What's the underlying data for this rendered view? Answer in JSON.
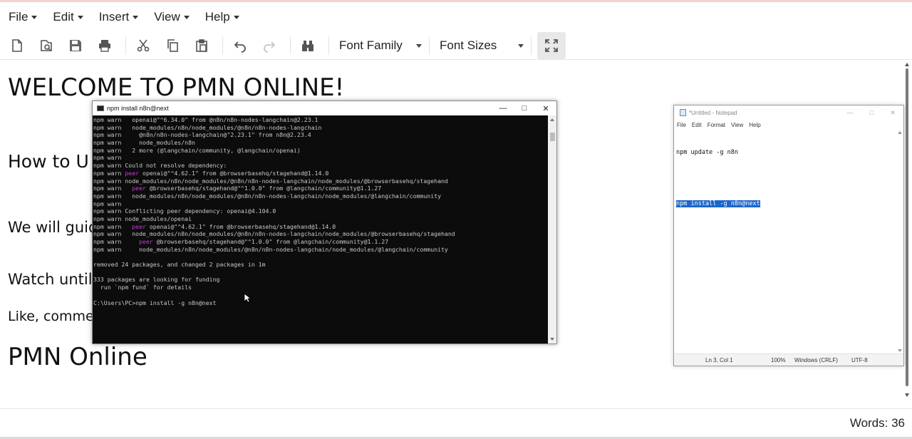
{
  "menubar": {
    "items": [
      "File",
      "Edit",
      "Insert",
      "View",
      "Help"
    ]
  },
  "toolbar": {
    "buttons": [
      "new-file-icon",
      "open-file-icon",
      "save-icon",
      "print-icon",
      "cut-icon",
      "copy-icon",
      "paste-icon",
      "undo-icon",
      "redo-icon",
      "find-icon"
    ],
    "font_family_label": "Font Family",
    "font_sizes_label": "Font Sizes",
    "fullscreen_icon": "fullscreen-icon"
  },
  "document": {
    "title": "WELCOME TO PMN ONLINE!",
    "line1": "How to U",
    "line2": "We will guid",
    "line3": "Watch until t",
    "line4": "Like, comme",
    "heading2": "PMN Online"
  },
  "statusbar": {
    "words": "Words: 36"
  },
  "cmd": {
    "title": "npm install n8n@next",
    "lines": [
      [
        "npm ",
        "warn",
        "   openai@\"^6.34.0\" from @n8n/n8n-nodes-langchain@2.23.1"
      ],
      [
        "npm ",
        "warn",
        "   node_modules/n8n/node_modules/@n8n/n8n-nodes-langchain"
      ],
      [
        "npm ",
        "warn",
        "     @n8n/n8n-nodes-langchain@\"2.23.1\" from n8n@2.23.4"
      ],
      [
        "npm ",
        "warn",
        "     node_modules/n8n"
      ],
      [
        "npm ",
        "warn",
        "   2 more (@langchain/community, @langchain/openai)"
      ],
      [
        "npm ",
        "warn",
        ""
      ],
      [
        "npm ",
        "warn",
        " Could not resolve dependency:"
      ],
      [
        "npm ",
        "warn",
        " peer openai@\"^4.62.1\" from @browserbasehq/stagehand@1.14.0"
      ],
      [
        "npm ",
        "warn",
        " node_modules/n8n/node_modules/@n8n/n8n-nodes-langchain/node_modules/@browserbasehq/stagehand"
      ],
      [
        "npm ",
        "warn",
        "   peer @browserbasehq/stagehand@\"^1.0.0\" from @langchain/community@1.1.27"
      ],
      [
        "npm ",
        "warn",
        "   node_modules/n8n/node_modules/@n8n/n8n-nodes-langchain/node_modules/@langchain/community"
      ],
      [
        "npm ",
        "warn",
        ""
      ],
      [
        "npm ",
        "warn",
        " Conflicting peer dependency: openai@4.104.0"
      ],
      [
        "npm ",
        "warn",
        " node_modules/openai"
      ],
      [
        "npm ",
        "warn",
        "   peer openai@\"^4.62.1\" from @browserbasehq/stagehand@1.14.0"
      ],
      [
        "npm ",
        "warn",
        "   node_modules/n8n/node_modules/@n8n/n8n-nodes-langchain/node_modules/@browserbasehq/stagehand"
      ],
      [
        "npm ",
        "warn",
        "     peer @browserbasehq/stagehand@\"^1.0.0\" from @langchain/community@1.1.27"
      ],
      [
        "npm ",
        "warn",
        "     node_modules/n8n/node_modules/@n8n/n8n-nodes-langchain/node_modules/@langchain/community"
      ],
      [
        "",
        "",
        ""
      ],
      [
        "",
        "",
        "removed 24 packages, and changed 2 packages in 1m"
      ],
      [
        "",
        "",
        ""
      ],
      [
        "",
        "",
        "333 packages are looking for funding"
      ],
      [
        "",
        "",
        "  run `npm fund` for details"
      ],
      [
        "",
        "",
        ""
      ],
      [
        "",
        "",
        "C:\\Users\\PC>npm install -g n8n@next"
      ]
    ]
  },
  "notepad": {
    "title": "*Untitled - Notepad",
    "menu": [
      "File",
      "Edit",
      "Format",
      "View",
      "Help"
    ],
    "lines": [
      "npm update -g n8n",
      "",
      "npm install -g n8n@next"
    ],
    "status": {
      "position": "Ln 3, Col 1",
      "zoom": "100%",
      "line_ending": "Windows (CRLF)",
      "encoding": "UTF-8"
    }
  },
  "colors": {
    "accent_selection": "#1a66cc",
    "cmd_background": "#0c0c0c",
    "cmd_peer_magenta": "#c23bd6"
  }
}
